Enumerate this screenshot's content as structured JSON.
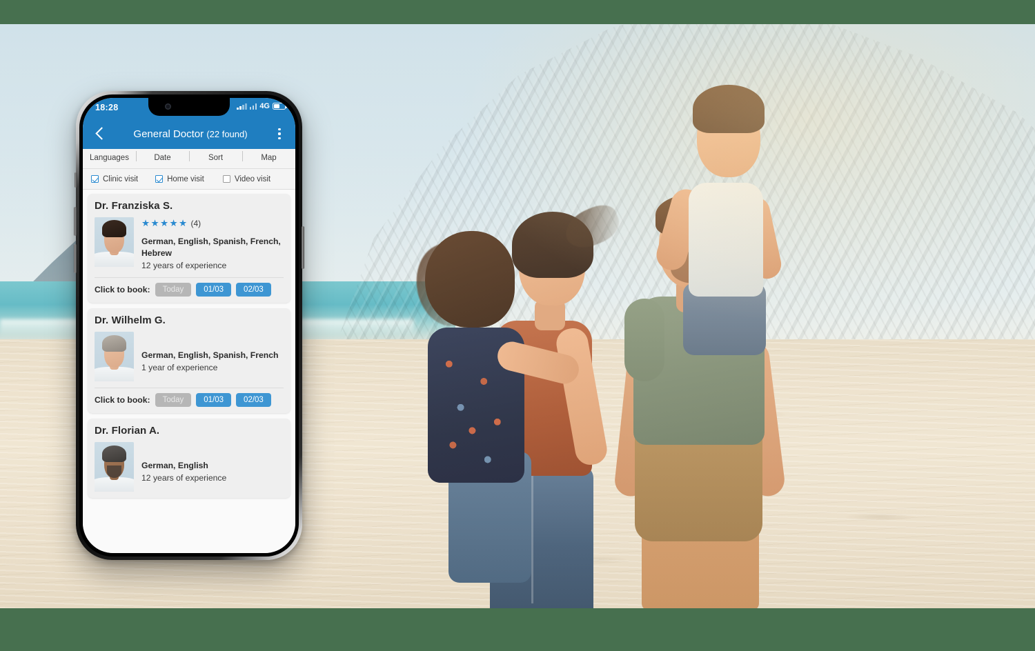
{
  "theme": {
    "frame_color": "#47704f",
    "brand_blue": "#1f7ec0",
    "slot_blue": "#3e96d3",
    "slot_disabled": "#b6b6b6",
    "star_blue": "#2a8ad0",
    "card_bg": "#efefef"
  },
  "status_bar": {
    "time": "18:28",
    "network": "4G",
    "signal_icon": "signal-bars-icon",
    "wifi_icon": "signal-bars-secondary-icon",
    "battery_icon": "battery-icon"
  },
  "app_bar": {
    "back_icon": "chevron-left-icon",
    "title": "General Doctor",
    "count": "(22 found)",
    "menu_icon": "overflow-menu-icon"
  },
  "filters": {
    "tabs": [
      {
        "label": "Languages"
      },
      {
        "label": "Date"
      },
      {
        "label": "Sort"
      },
      {
        "label": "Map"
      }
    ],
    "checkboxes": [
      {
        "label": "Clinic visit",
        "checked": true
      },
      {
        "label": "Home visit",
        "checked": true
      },
      {
        "label": "Video visit",
        "checked": false
      }
    ]
  },
  "book_label": "Click to book:",
  "doctors": [
    {
      "name": "Dr. Franziska S.",
      "avatar_icon": "doctor-avatar-franziska",
      "stars": "★★★★★",
      "rating_count": "(4)",
      "languages": "German, English, Spanish, French, Hebrew",
      "experience": "12 years of experience",
      "slots": [
        {
          "label": "Today",
          "disabled": true
        },
        {
          "label": "01/03",
          "disabled": false
        },
        {
          "label": "02/03",
          "disabled": false
        }
      ]
    },
    {
      "name": "Dr. Wilhelm G.",
      "avatar_icon": "doctor-avatar-wilhelm",
      "stars": "",
      "rating_count": "",
      "languages": "German, English, Spanish, French",
      "experience": "1 year of experience",
      "slots": [
        {
          "label": "Today",
          "disabled": true
        },
        {
          "label": "01/03",
          "disabled": false
        },
        {
          "label": "02/03",
          "disabled": false
        }
      ]
    },
    {
      "name": "Dr. Florian A.",
      "avatar_icon": "doctor-avatar-florian",
      "stars": "",
      "rating_count": "",
      "languages": "German, English",
      "experience": "12 years of experience",
      "slots": []
    }
  ],
  "background_photo": {
    "description": "Family of four walking on a sunny beach with a rocky mountain cliff behind them",
    "alt_icon": "beach-family-photo"
  }
}
